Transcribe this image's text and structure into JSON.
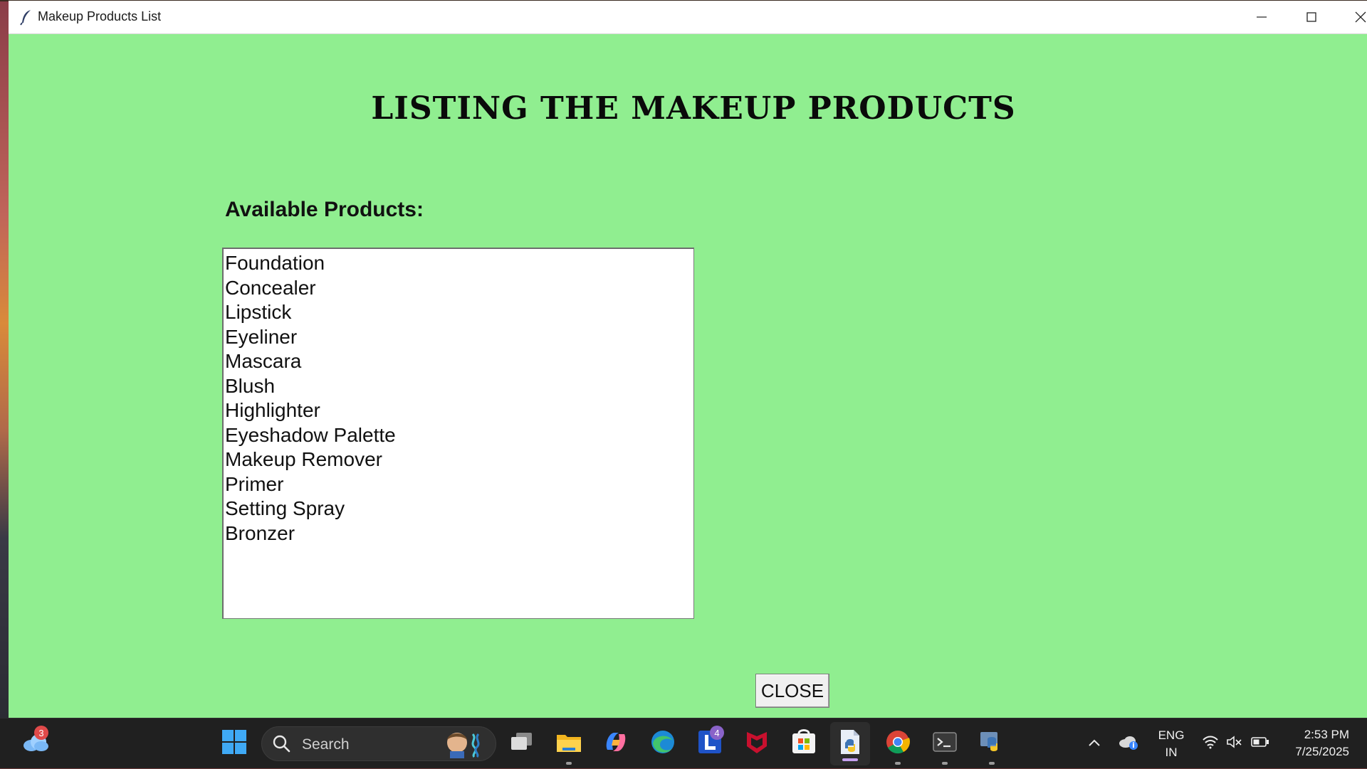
{
  "window": {
    "title": "Makeup Products List",
    "app_icon": "feather-icon",
    "controls": [
      "minimize-icon",
      "maximize-icon",
      "close-icon"
    ]
  },
  "main": {
    "heading": "LISTING THE MAKEUP PRODUCTS",
    "list_label": "Available Products:",
    "products": [
      "Foundation",
      "Concealer",
      "Lipstick",
      "Eyeliner",
      "Mascara",
      "Blush",
      "Highlighter",
      "Eyeshadow Palette",
      "Makeup Remover",
      "Primer",
      "Setting Spray",
      "Bronzer"
    ],
    "close_label": "CLOSE"
  },
  "taskbar": {
    "weather_badge": "3",
    "search_placeholder": "Search",
    "apps": [
      {
        "name": "task-view-icon"
      },
      {
        "name": "file-explorer-icon"
      },
      {
        "name": "copilot-icon"
      },
      {
        "name": "edge-icon"
      },
      {
        "name": "l-app-icon",
        "badge": "4"
      },
      {
        "name": "mcafee-icon"
      },
      {
        "name": "microsoft-store-icon"
      },
      {
        "name": "python-idle-icon"
      },
      {
        "name": "chrome-icon"
      },
      {
        "name": "terminal-icon"
      },
      {
        "name": "python-icon"
      }
    ],
    "tray": {
      "language_line1": "ENG",
      "language_line2": "IN",
      "time": "2:53 PM",
      "date": "7/25/2025"
    }
  },
  "colors": {
    "window_bg": "#90ee90",
    "list_bg": "#ffffff",
    "taskbar_bg": "#202020"
  }
}
